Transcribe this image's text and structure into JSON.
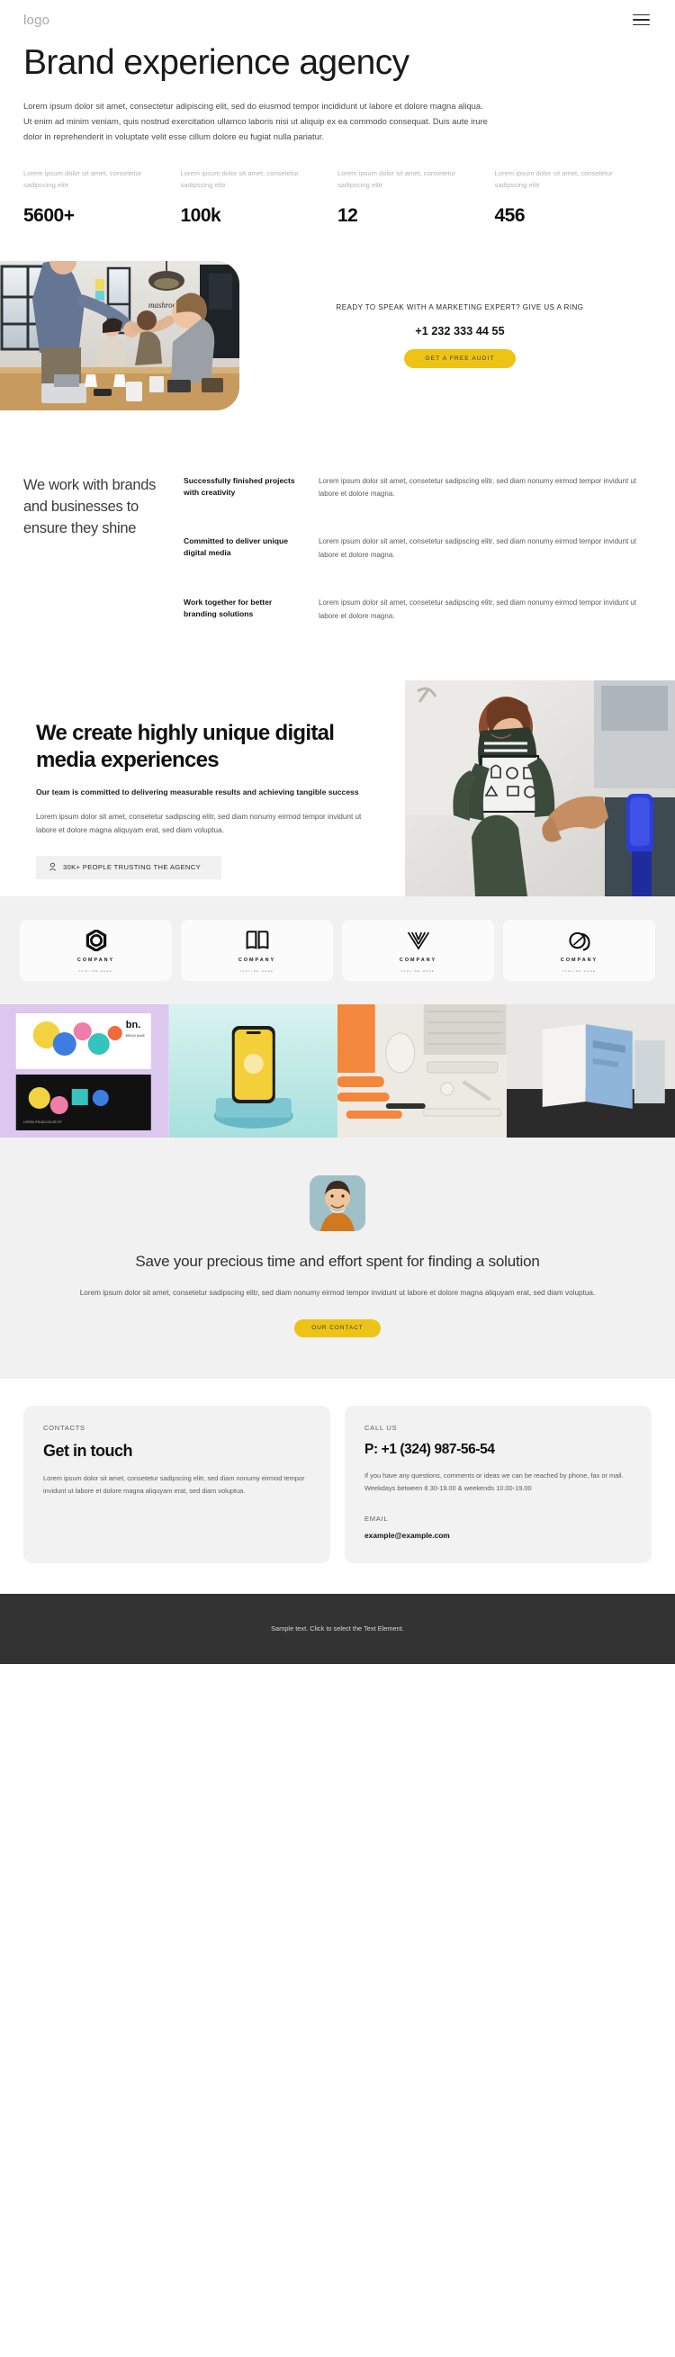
{
  "header": {
    "logo": "logo",
    "menu_icon": "hamburger-menu-icon"
  },
  "hero": {
    "title": "Brand experience agency",
    "lead": "Lorem ipsum dolor sit amet, consectetur adipiscing elit, sed do eiusmod tempor incididunt ut labore et dolore magna aliqua. Ut enim ad minim veniam, quis nostrud exercitation ullamco laboris nisi ut aliquip ex ea commodo consequat. Duis aute irure dolor in reprehenderit in voluptate velit esse cillum dolore eu fugiat nulla pariatur."
  },
  "stats": [
    {
      "caption": "Lorem ipsum dolor sit amet, consetetur sadipscing elitr",
      "value": "5600+"
    },
    {
      "caption": "Lorem ipsum dolor sit amet, consetetur sadipscing elitr",
      "value": "100k"
    },
    {
      "caption": "Lorem ipsum dolor sit amet, consetetur sadipscing elitr",
      "value": "12"
    },
    {
      "caption": "Lorem ipsum dolor sit amet, consetetur sadipscing elitr",
      "value": "456"
    }
  ],
  "feature": {
    "image_alt": "office-handshake-meeting-photo",
    "kicker": "READY TO SPEAK WITH A MARKETING EXPERT? GIVE US A RING",
    "phone": "+1 232 333 44 55",
    "cta_label": "GET A FREE AUDIT",
    "accent_color": "#edc316"
  },
  "workwith": {
    "heading": "We work with brands and businesses to ensure they shine",
    "items": [
      {
        "title": "Successfully finished projects with creativity",
        "description": "Lorem ipsum dolor sit amet, consetetur sadipscing elitr, sed diam nonumy eirmod tempor invidunt ut labore et dolore magna."
      },
      {
        "title": "Committed to deliver unique digital media",
        "description": "Lorem ipsum dolor sit amet, consetetur sadipscing elitr, sed diam nonumy eirmod tempor invidunt ut labore et dolore magna."
      },
      {
        "title": "Work together for better branding solutions",
        "description": "Lorem ipsum dolor sit amet, consetetur sadipscing elitr, sed diam nonumy eirmod tempor invidunt ut labore et dolore magna."
      }
    ]
  },
  "create": {
    "heading": "We create highly unique digital media experiences",
    "subheading": "Our team is committed to delivering measurable results and achieving tangible success",
    "body": "Lorem ipsum dolor sit amet, consetetur sadipscing elitr, sed diam nonumy eirmod tempor invidunt ut labore et dolore magna aliquyam erat, sed diam voluptua.",
    "badge_label": "30K+ PEOPLE TRUSTING THE AGENCY",
    "badge_icon": "person-icon",
    "image_alt": "woman-holding-sketchbook-photo"
  },
  "logos": [
    {
      "mark": "circle-hexagon-logo-icon",
      "name": "COMPANY",
      "tagline": "TAGLINE HERE"
    },
    {
      "mark": "open-book-logo-icon",
      "name": "COMPANY",
      "tagline": "TAGLINE HERE"
    },
    {
      "mark": "crown-lines-logo-icon",
      "name": "COMPANY",
      "tagline": "TAGLINE HERE"
    },
    {
      "mark": "overlapping-circles-logo-icon",
      "name": "COMPANY",
      "tagline": "TAGLINE HERE"
    }
  ],
  "gallery": [
    {
      "alt": "brand-poster-design-artwork"
    },
    {
      "alt": "yellow-phone-mockup-on-podium"
    },
    {
      "alt": "desk-stationery-flatlay"
    },
    {
      "alt": "blue-card-stationery-mockup"
    }
  ],
  "save": {
    "avatar_alt": "smiling-man-portrait-avatar",
    "heading": "Save your precious time and effort spent for finding a solution",
    "body": "Lorem ipsum dolor sit amet, consetetur sadipscing elitr, sed diam nonumy eirmod tempor invidunt ut labore et dolore magna aliquyam erat, sed diam voluptua.",
    "cta_label": "OUR CONTACT"
  },
  "contact": {
    "left": {
      "label": "CONTACTS",
      "title": "Get in touch",
      "body": "Lorem ipsum dolor sit amet, consetetur sadipscing elitr, sed diam nonumy eirmod tempor invidunt ut labore et dolore magna aliquyam erat, sed diam voluptua."
    },
    "right": {
      "label": "CALL US",
      "phone": "P: +1 (324) 987-56-54",
      "body": "If you have any questions, comments or ideas we can be reached by phone, fax or mail. Weekdays between 8.30-19.00 & weekends 10.00-19.00",
      "email_label": "EMAIL",
      "email": "example@example.com"
    }
  },
  "bottombar": {
    "text": "Sample text. Click to select the Text Element."
  }
}
